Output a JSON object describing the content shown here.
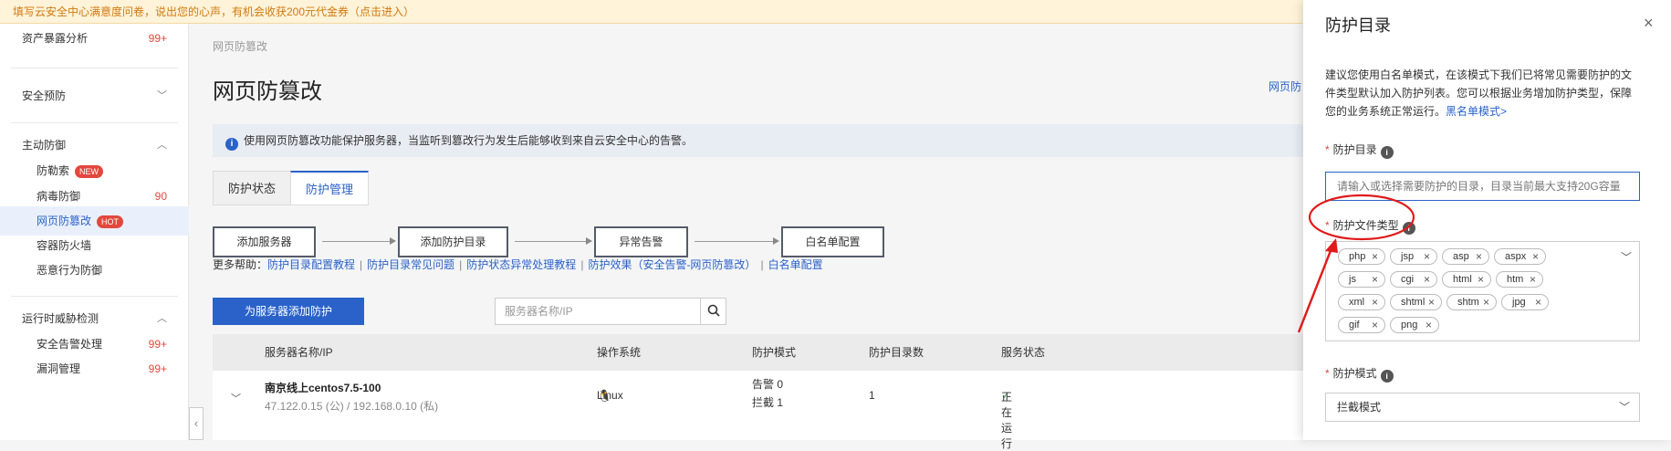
{
  "banner": "填写云安全中心满意度问卷，说出您的心声，有机会收获200元代金券（点击进入）",
  "sidebar": {
    "items": [
      {
        "label": "资产暴露分析",
        "count": "99+"
      },
      {
        "label": "安全预防"
      },
      {
        "label": "主动防御"
      },
      {
        "label": "防勒索",
        "badge": "NEW"
      },
      {
        "label": "病毒防御",
        "count": "90"
      },
      {
        "label": "网页防篡改",
        "badge": "HOT"
      },
      {
        "label": "容器防火墙"
      },
      {
        "label": "恶意行为防御"
      },
      {
        "label": "运行时威胁检测"
      },
      {
        "label": "安全告警处理",
        "count": "99+"
      },
      {
        "label": "漏洞管理",
        "count": "99+"
      }
    ],
    "collapse_icon": "‹"
  },
  "main": {
    "breadcrumb": "网页防篡改",
    "title": "网页防篡改",
    "right_link": "网页防",
    "info": "使用网页防篡改功能保护服务器，当监听到篡改行为发生后能够收到来自云安全中心的告警。",
    "info_icon": "i",
    "tabs": [
      "防护状态",
      "防护管理"
    ],
    "steps": [
      "添加服务器",
      "添加防护目录",
      "异常告警",
      "白名单配置"
    ],
    "help": {
      "prefix": "更多帮助：",
      "links": [
        "防护目录配置教程",
        "防护目录常见问题",
        "防护状态异常处理教程",
        "防护效果（安全告警-网页防篡改）",
        "白名单配置"
      ],
      "sep": "|"
    },
    "add_button": "为服务器添加防护",
    "search_placeholder": "服务器名称/IP",
    "table": {
      "columns": [
        "服务器名称/IP",
        "操作系统",
        "防护模式",
        "防护目录数",
        "服务状态"
      ],
      "row": {
        "name": "南京线上centos7.5-100",
        "ip": "47.122.0.15 (公) / 192.168.0.10 (私)",
        "os": "Linux",
        "mode_line1": "告警 0",
        "mode_line2": "拦截 1",
        "dir_count": "1",
        "status": "正在运行"
      }
    }
  },
  "drawer": {
    "title": "防护目录",
    "close": "×",
    "desc": "建议您使用白名单模式，在该模式下我们已将常见需要防护的文件类型默认加入防护列表。您可以根据业务增加防护类型，保障您的业务系统正常运行。",
    "desc_link": "黑名单模式>",
    "dir_label": "防护目录",
    "dir_placeholder": "请输入或选择需要防护的目录，目录当前最大支持20G容量",
    "type_label": "防护文件类型",
    "file_types": [
      "php",
      "jsp",
      "asp",
      "aspx",
      "js",
      "cgi",
      "html",
      "htm",
      "xml",
      "shtml",
      "shtm",
      "jpg",
      "gif",
      "png"
    ],
    "mode_label": "防护模式",
    "mode_value": "拦截模式",
    "required_mark": "*",
    "help_icon": "i"
  },
  "colors": {
    "accent": "#2a62c9",
    "danger": "#e2483d",
    "annotation": "#e01b1b"
  }
}
